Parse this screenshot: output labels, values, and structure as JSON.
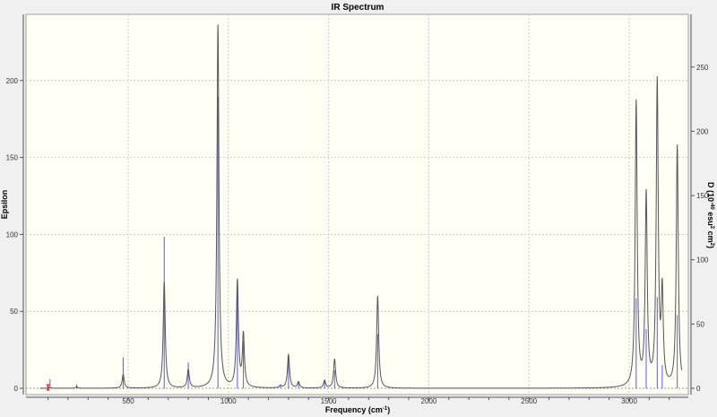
{
  "chart_data": {
    "type": "line",
    "title": "IR Spectrum",
    "xlabel": "Frequency (cm",
    "xlabel_sup": "-1",
    "xlabel_end": ")",
    "ylabel": "Epsilon",
    "y2label": "D (10",
    "y2label_sup1": "-40",
    "y2label_mid": " esu",
    "y2label_sup2": "2",
    "y2label_mid2": " cm",
    "y2label_sup3": "2",
    "y2label_end": ")",
    "xlim": [
      0,
      3300
    ],
    "ylim": [
      0,
      243
    ],
    "y2lim": [
      0,
      291
    ],
    "xticks": [
      500,
      1000,
      1500,
      2000,
      2500,
      3000
    ],
    "yticks": [
      0,
      50,
      100,
      150,
      200
    ],
    "y2ticks": [
      0,
      50,
      100,
      150,
      200,
      250
    ],
    "grid": true,
    "colors": {
      "curve": "#000000",
      "sticks": "#3a3aff",
      "marker": "#ff0000",
      "plot_bg": "#fffff5"
    },
    "peaks_columns": [
      "frequency",
      "epsilon",
      "D"
    ],
    "peaks": [
      [
        110,
        0.5,
        7
      ],
      [
        243,
        1,
        3
      ],
      [
        475,
        9,
        24
      ],
      [
        680,
        69,
        118
      ],
      [
        800,
        12,
        20
      ],
      [
        948,
        236,
        227
      ],
      [
        1045,
        69,
        74
      ],
      [
        1075,
        34,
        37
      ],
      [
        1260,
        1.5,
        2
      ],
      [
        1300,
        22,
        23
      ],
      [
        1350,
        4,
        5
      ],
      [
        1480,
        5,
        6
      ],
      [
        1530,
        19,
        14
      ],
      [
        1745,
        60,
        42
      ],
      [
        3035,
        185,
        70
      ],
      [
        3085,
        124,
        46
      ],
      [
        3140,
        197,
        71
      ],
      [
        3165,
        59,
        18
      ],
      [
        3240,
        157,
        57
      ]
    ],
    "marker_frequency": 100
  }
}
